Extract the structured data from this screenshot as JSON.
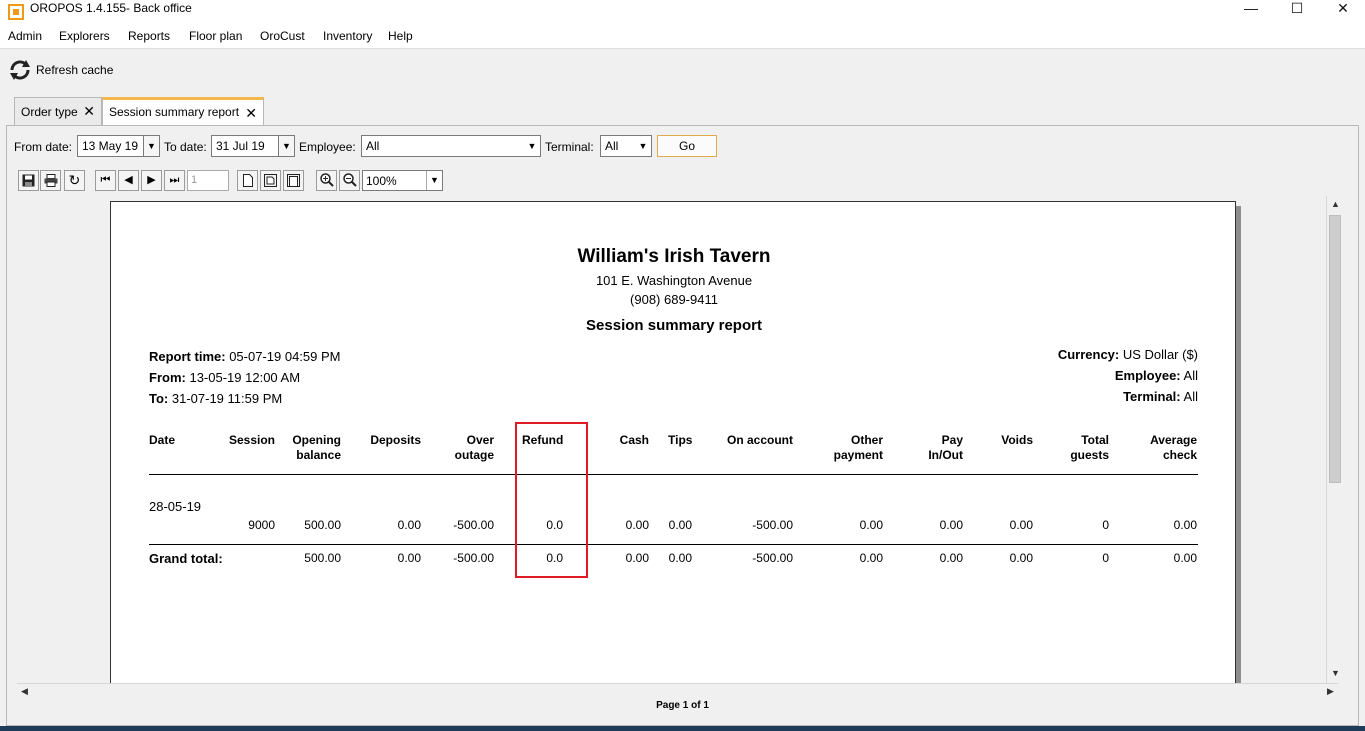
{
  "window": {
    "title": "OROPOS 1.4.155- Back office",
    "minimize": "—",
    "maximize": "☐",
    "close": "✕"
  },
  "menu": [
    "Admin",
    "Explorers",
    "Reports",
    "Floor plan",
    "OroCust",
    "Inventory",
    "Help"
  ],
  "toolbar": {
    "refresh_label": "Refresh cache"
  },
  "tabs": [
    {
      "label": "Order type",
      "close": "✕"
    },
    {
      "label": "Session summary report",
      "close": "✕"
    }
  ],
  "filters": {
    "from_label": "From date:",
    "from_value": "13 May 19",
    "to_label": "To date:",
    "to_value": "31 Jul 19",
    "employee_label": "Employee:",
    "employee_value": "All",
    "terminal_label": "Terminal:",
    "terminal_value": "All",
    "go_label": "Go"
  },
  "viewer": {
    "page_field": "1",
    "zoom": "100%",
    "status": "Page 1 of 1"
  },
  "report": {
    "name": "William's Irish Tavern",
    "address": "101 E. Washington Avenue",
    "phone": "(908) 689-9411",
    "title": "Session summary report",
    "report_time_label": "Report time:",
    "report_time": "05-07-19 04:59 PM",
    "from_label": "From:",
    "from": "13-05-19 12:00 AM",
    "to_label": "To:",
    "to": "31-07-19 11:59 PM",
    "currency_label": "Currency:",
    "currency": "US Dollar ($)",
    "employee_label": "Employee:",
    "employee": "All",
    "terminal_label": "Terminal:",
    "terminal": "All",
    "columns": [
      "Date",
      "Session",
      "Opening\nbalance",
      "Deposits",
      "Over\noutage",
      "Refund",
      "Cash",
      "Tips",
      "On account",
      "Other\npayment",
      "Pay\nIn/Out",
      "Voids",
      "Total\nguests",
      "Average\ncheck"
    ],
    "row_date": "28-05-19",
    "row": [
      "9000",
      "500.00",
      "0.00",
      "-500.00",
      "0.0",
      "0.00",
      "0.00",
      "-500.00",
      "0.00",
      "0.00",
      "0.00",
      "0",
      "0.00"
    ],
    "grand_total_label": "Grand total:",
    "grand_total": [
      "500.00",
      "0.00",
      "-500.00",
      "0.0",
      "0.00",
      "0.00",
      "-500.00",
      "0.00",
      "0.00",
      "0.00",
      "0",
      "0.00"
    ]
  }
}
